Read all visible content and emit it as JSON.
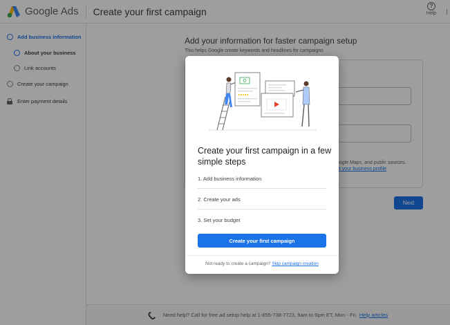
{
  "header": {
    "brand_google": "Google",
    "brand_ads": "Ads",
    "page_title": "Create your first campaign",
    "help_label": "Help"
  },
  "sidebar": {
    "steps": [
      {
        "label": "Add business information"
      },
      {
        "label": "About your business"
      },
      {
        "label": "Link accounts"
      },
      {
        "label": "Create your campaign"
      },
      {
        "label": "Enter payment details"
      }
    ]
  },
  "background": {
    "heading": "Add your information for faster campaign setup",
    "subheading": "This helps Google create keywords and headlines for campaigns",
    "help_text": "oogle Maps, and public sources.",
    "help_link": "ut your business profile",
    "next_label": "Next"
  },
  "footer": {
    "text": "Need help? Call for free ad setup help at 1-855-738-7723, 9am to 9pm ET, Mon - Fri.",
    "link": "Help articles"
  },
  "modal": {
    "title": "Create your first campaign in a few simple steps",
    "steps": [
      {
        "label": "1. Add business information"
      },
      {
        "label": "2. Create your ads"
      },
      {
        "label": "3. Set your budget"
      }
    ],
    "primary_button": "Create your first campaign",
    "footer_text": "Not ready to create a campaign?",
    "footer_link": "Skip campaign creation"
  },
  "colors": {
    "accent": "#1a73e8",
    "overlay": "rgba(0,0,0,0.38)"
  }
}
